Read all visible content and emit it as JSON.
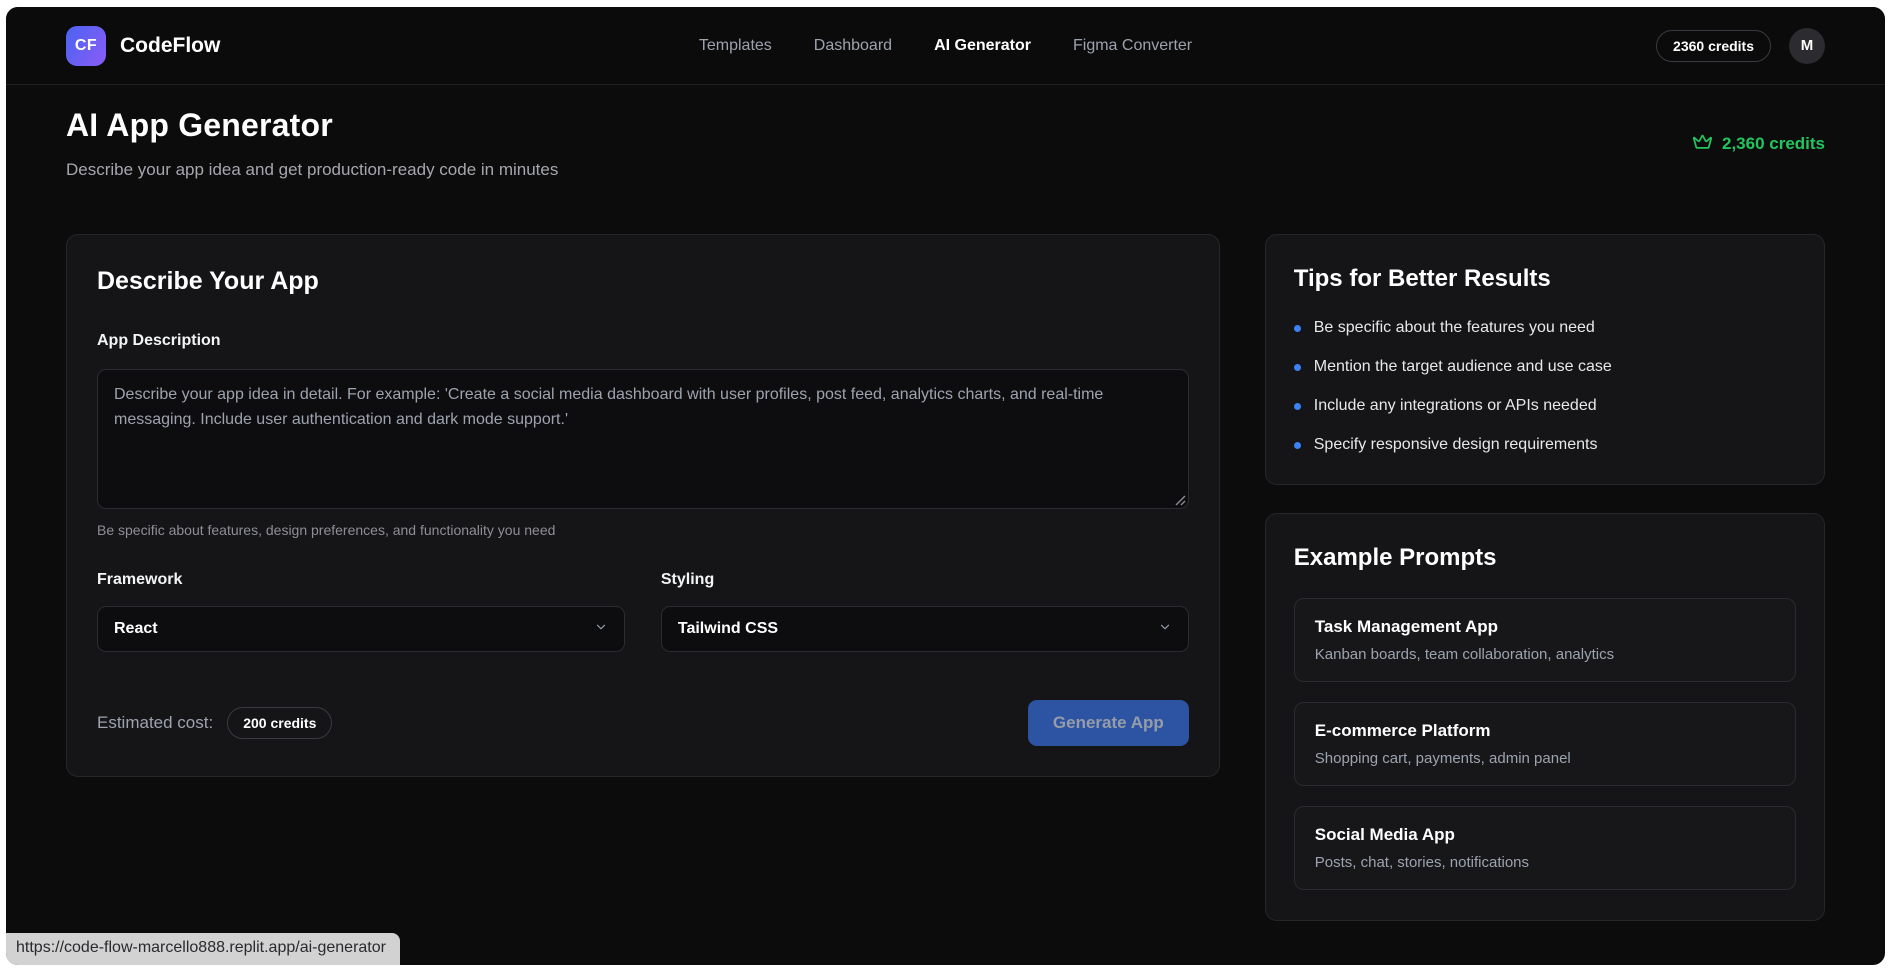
{
  "nav": {
    "logo_text": "CF",
    "brand": "CodeFlow",
    "items": [
      {
        "label": "Templates"
      },
      {
        "label": "Dashboard"
      },
      {
        "label": "AI Generator"
      },
      {
        "label": "Figma Converter"
      }
    ],
    "credits_badge": "2360 credits",
    "avatar_initial": "M"
  },
  "header": {
    "title": "AI App Generator",
    "subtitle": "Describe your app idea and get production-ready code in minutes",
    "credits": "2,360 credits"
  },
  "form": {
    "card_title": "Describe Your App",
    "description_label": "App Description",
    "description_placeholder": "Describe your app idea in detail. For example: 'Create a social media dashboard with user profiles, post feed, analytics charts, and real-time messaging. Include user authentication and dark mode support.'",
    "description_help": "Be specific about features, design preferences, and functionality you need",
    "framework_label": "Framework",
    "framework_value": "React",
    "styling_label": "Styling",
    "styling_value": "Tailwind CSS",
    "estimated_cost_label": "Estimated cost:",
    "estimated_cost_value": "200 credits",
    "generate_button": "Generate App"
  },
  "tips": {
    "title": "Tips for Better Results",
    "items": [
      "Be specific about the features you need",
      "Mention the target audience and use case",
      "Include any integrations or APIs needed",
      "Specify responsive design requirements"
    ]
  },
  "examples": {
    "title": "Example Prompts",
    "items": [
      {
        "title": "Task Management App",
        "subtitle": "Kanban boards, team collaboration, analytics"
      },
      {
        "title": "E-commerce Platform",
        "subtitle": "Shopping cart, payments, admin panel"
      },
      {
        "title": "Social Media App",
        "subtitle": "Posts, chat, stories, notifications"
      }
    ]
  },
  "status": {
    "url": "https://code-flow-marcello888.replit.app/ai-generator"
  },
  "colors": {
    "accent_blue": "#3b82f6",
    "button_blue": "#2d53a3",
    "credits_green": "#22c55e",
    "logo_gradient_start": "#4a63f2",
    "logo_gradient_end": "#8b5cf6"
  }
}
